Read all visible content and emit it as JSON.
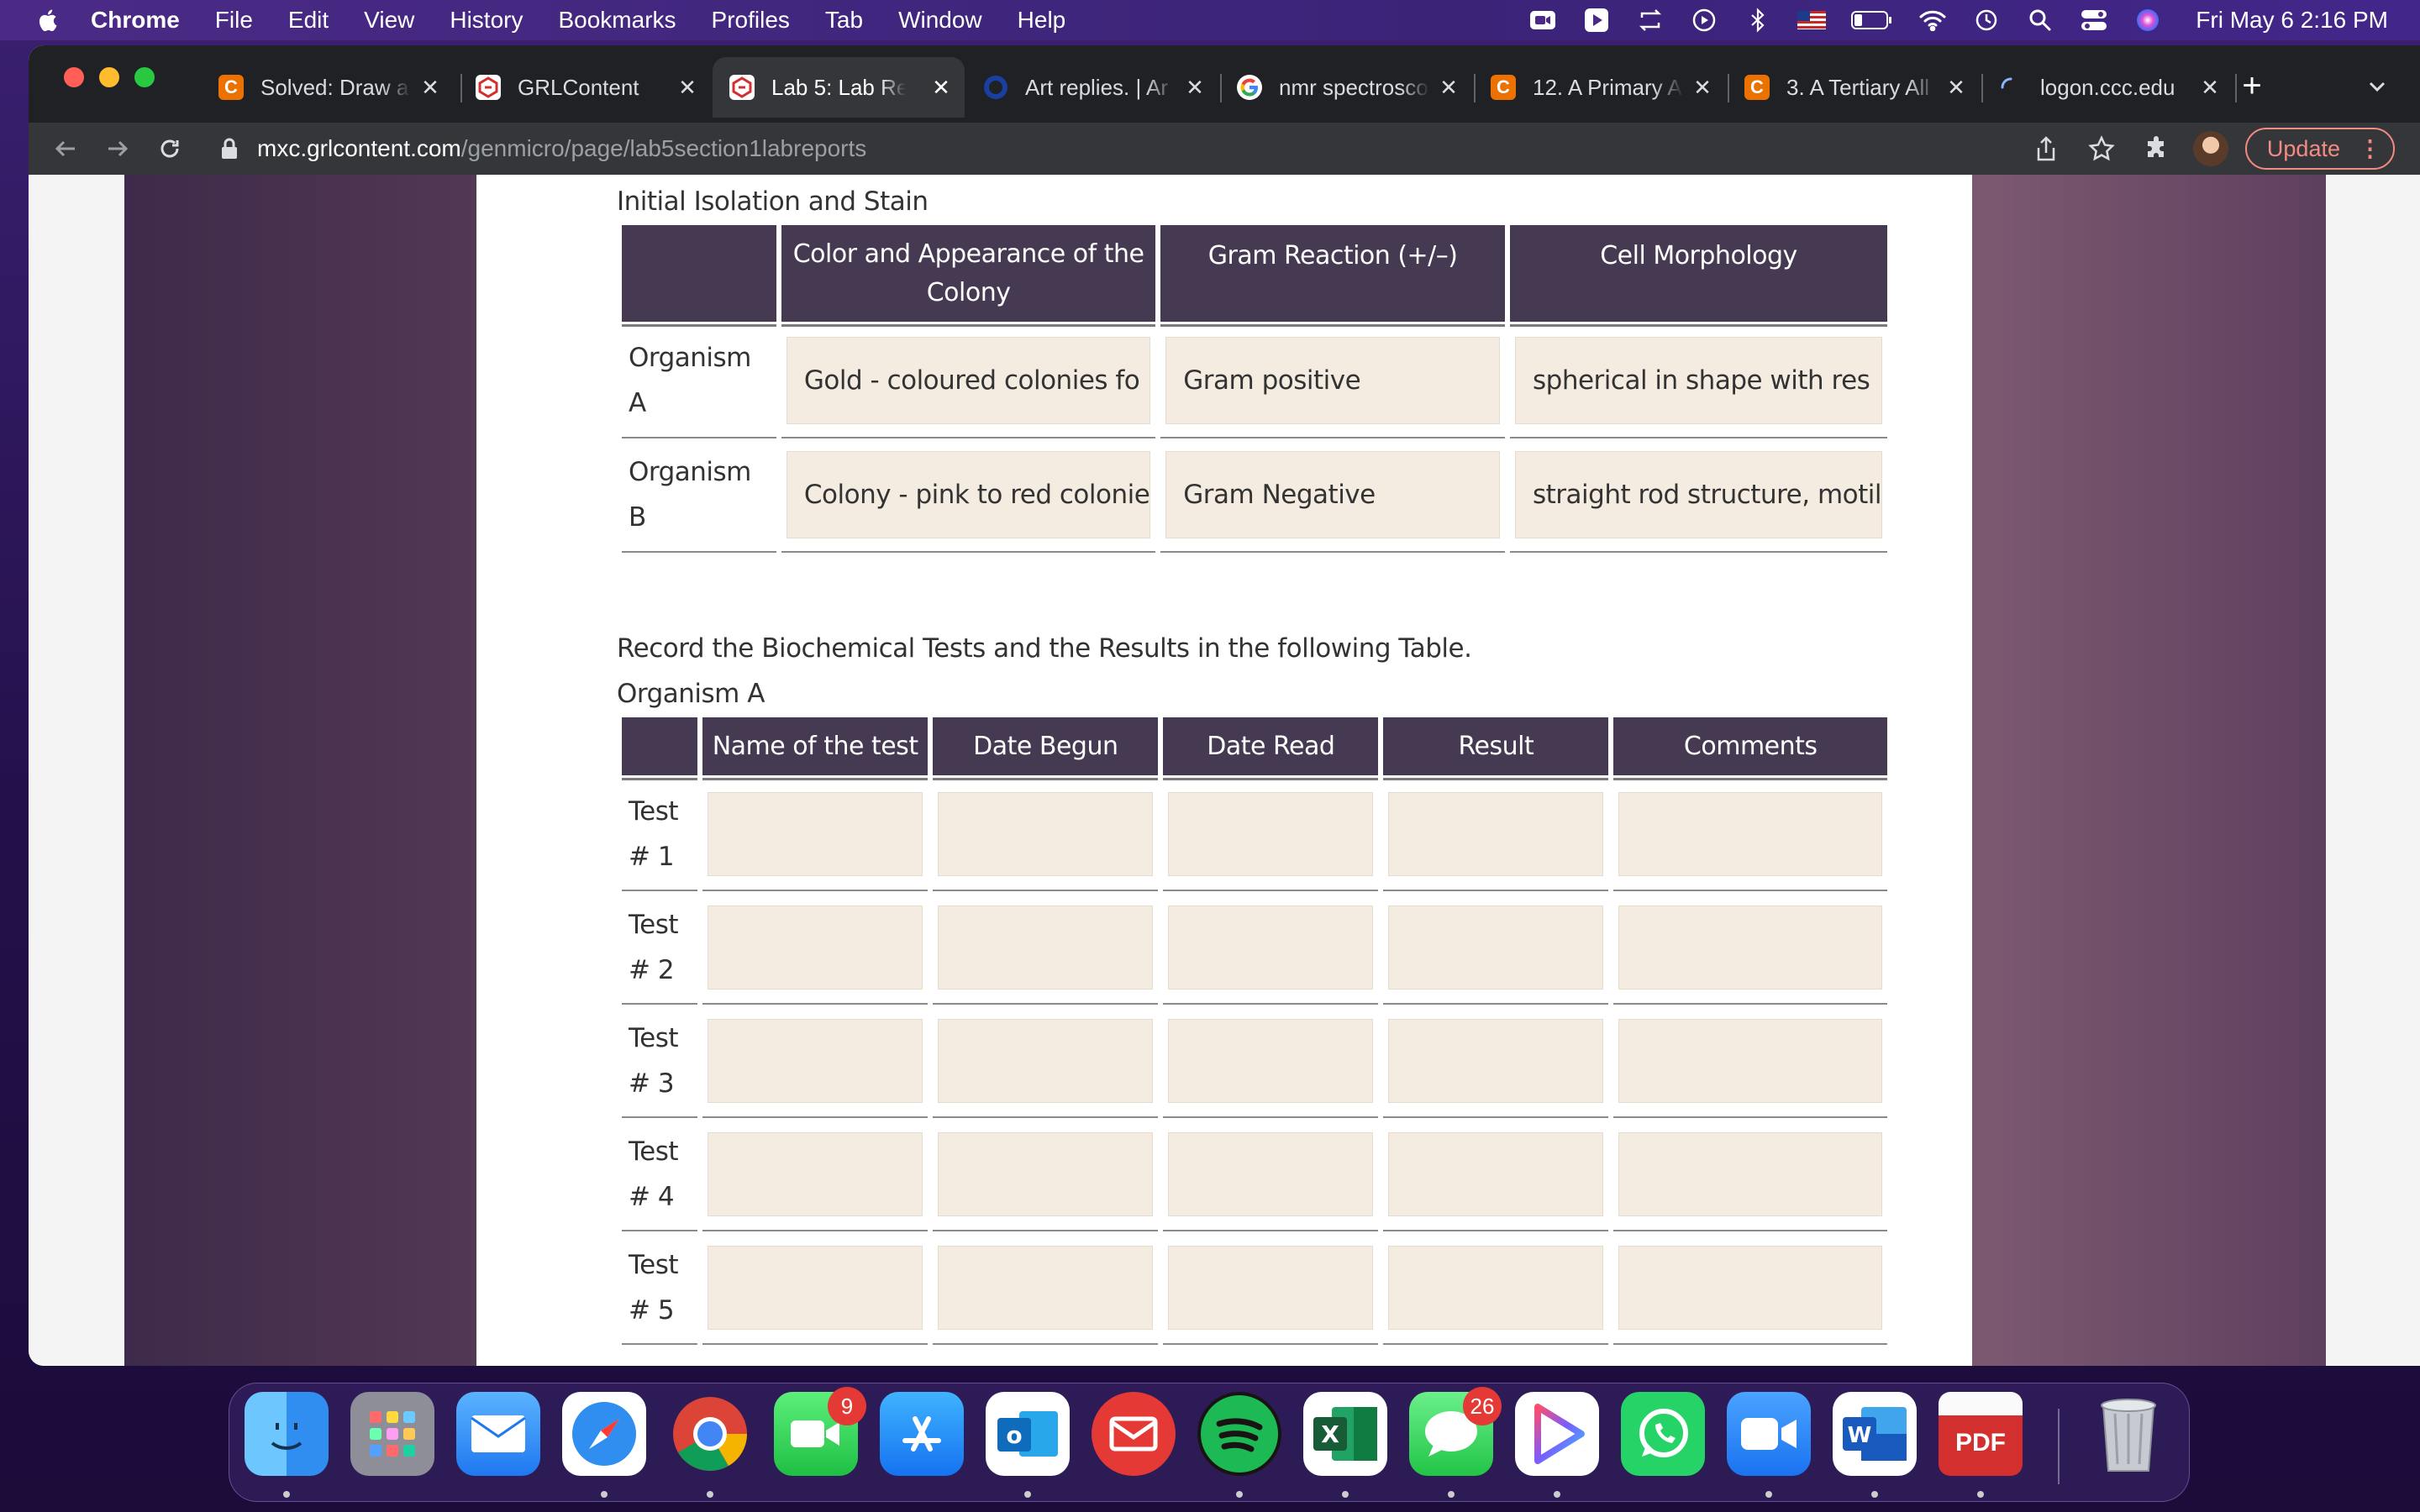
{
  "menubar": {
    "app_name": "Chrome",
    "items": [
      "File",
      "Edit",
      "View",
      "History",
      "Bookmarks",
      "Profiles",
      "Tab",
      "Window",
      "Help"
    ],
    "clock": "Fri May 6  2:16 PM"
  },
  "browser": {
    "tabs": [
      {
        "title": "Solved: Draw a",
        "favicon": "chegg-icon",
        "favicon_text": "C",
        "color": "#eb7100"
      },
      {
        "title": "GRLContent",
        "favicon": "grl-icon",
        "favicon_text": "",
        "color": "#ffffff"
      },
      {
        "title": "Lab 5: Lab Rep",
        "favicon": "grl-icon",
        "favicon_text": "",
        "color": "#ffffff",
        "active": true
      },
      {
        "title": "Art replies. | Ar",
        "favicon": "circle-icon",
        "favicon_text": "",
        "color": "#1a3fa0"
      },
      {
        "title": "nmr spectrosco",
        "favicon": "google-icon",
        "favicon_text": "G",
        "color": "#ffffff"
      },
      {
        "title": "12. A Primary A",
        "favicon": "chegg-icon",
        "favicon_text": "C",
        "color": "#eb7100"
      },
      {
        "title": "3. A Tertiary All",
        "favicon": "chegg-icon",
        "favicon_text": "C",
        "color": "#eb7100"
      },
      {
        "title": "logon.ccc.edu",
        "favicon": "loading-icon",
        "favicon_text": "",
        "color": "#8ab4f8"
      }
    ],
    "url_host": "mxc.grlcontent.com",
    "url_path": "/genmicro/page/lab5section1labreports",
    "update_label": "Update"
  },
  "page": {
    "section1_title": "Initial Isolation and Stain",
    "table1": {
      "headers": [
        "",
        "Color and Appearance of the Colony",
        "Gram Reaction (+/–)",
        "Cell Morphology"
      ],
      "rows": [
        {
          "label": "Organism A",
          "color": "Gold - coloured colonies fo",
          "gram": "Gram positive",
          "morphology": "spherical in shape with res"
        },
        {
          "label": "Organism B",
          "color": "Colony - pink to red colonie",
          "gram": "Gram Negative",
          "morphology": "straight rod structure, motil"
        }
      ]
    },
    "section2_title": "Record the Biochemical Tests and the Results in the following Table.",
    "section2_subtitle": "Organism A",
    "table2": {
      "headers": [
        "",
        "Name of the test",
        "Date Begun",
        "Date Read",
        "Result",
        "Comments"
      ],
      "rows": [
        {
          "label": "Test # 1",
          "name": "",
          "begun": "",
          "read": "",
          "result": "",
          "comments": ""
        },
        {
          "label": "Test # 2",
          "name": "",
          "begun": "",
          "read": "",
          "result": "",
          "comments": ""
        },
        {
          "label": "Test # 3",
          "name": "",
          "begun": "",
          "read": "",
          "result": "",
          "comments": ""
        },
        {
          "label": "Test # 4",
          "name": "",
          "begun": "",
          "read": "",
          "result": "",
          "comments": ""
        },
        {
          "label": "Test # 5",
          "name": "",
          "begun": "",
          "read": "",
          "result": "",
          "comments": ""
        }
      ]
    }
  },
  "dock": {
    "apps": [
      {
        "name": "finder-icon",
        "color": "#3aa0f0"
      },
      {
        "name": "launchpad-icon",
        "color": "#8e8e99"
      },
      {
        "name": "mail-icon",
        "color": "#3d8ef7"
      },
      {
        "name": "safari-icon",
        "color": "#2f7fe6"
      },
      {
        "name": "chrome-icon",
        "color": "#ffffff"
      },
      {
        "name": "facetime-icon",
        "color": "#2ecc52",
        "badge": "9"
      },
      {
        "name": "app-store-icon",
        "color": "#1f8ef5"
      },
      {
        "name": "outlook-icon",
        "color": "#ffffff"
      },
      {
        "name": "email-icon",
        "color": "#e53935"
      },
      {
        "name": "spotify-icon",
        "color": "#1db954"
      },
      {
        "name": "excel-icon",
        "color": "#1f7244"
      },
      {
        "name": "messages-icon",
        "color": "#34c759",
        "badge": "26"
      },
      {
        "name": "infuse-icon",
        "color": "#ffffff"
      },
      {
        "name": "whatsapp-icon",
        "color": "#25d366"
      },
      {
        "name": "zoom-icon",
        "color": "#2d8cff"
      },
      {
        "name": "word-icon",
        "color": "#ffffff"
      },
      {
        "name": "pdf-icon",
        "color": "#d32f2f",
        "label": "PDF"
      },
      {
        "name": "trash-icon",
        "color": "#b0b4ba"
      }
    ]
  }
}
